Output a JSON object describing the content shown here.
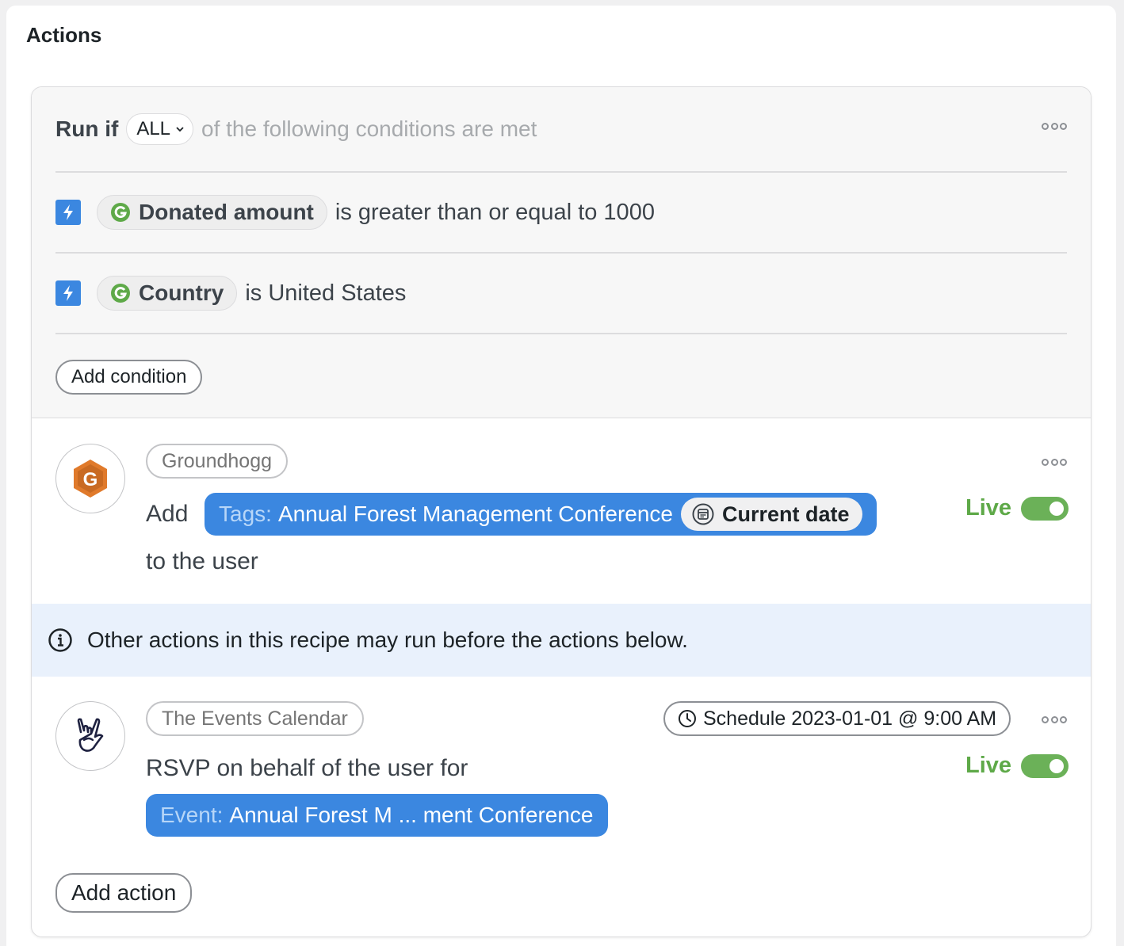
{
  "panel": {
    "title": "Actions"
  },
  "conditions": {
    "run_if_label": "Run if",
    "match_mode": "ALL",
    "run_if_suffix": "of the following conditions are met",
    "items": [
      {
        "field": "Donated amount",
        "rule": "is greater than or equal to 1000",
        "icon": "groundhogg-icon",
        "trigger_icon": "bolt-icon"
      },
      {
        "field": "Country",
        "rule": "is United States",
        "icon": "groundhogg-icon",
        "trigger_icon": "bolt-icon"
      }
    ],
    "add_condition_label": "Add condition"
  },
  "actions": [
    {
      "integration": "Groundhogg",
      "verb": "Add",
      "token_key": "Tags:",
      "token_value": "Annual Forest Management Conference",
      "date_chip": "Current date",
      "suffix": "to the user",
      "status": "Live",
      "icon": "groundhogg-logo"
    },
    {
      "integration": "The Events Calendar",
      "schedule": "Schedule 2023-01-01 @ 9:00 AM",
      "sentence": "RSVP on behalf of the user for",
      "token_key": "Event:",
      "token_value": "Annual Forest M ... ment Conference",
      "status": "Live",
      "icon": "rock-hand-logo"
    }
  ],
  "notice": {
    "text": "Other actions in this recipe may run before the actions below.",
    "icon": "info-icon"
  },
  "add_action_label": "Add action",
  "colors": {
    "accent_blue": "#3b87e0",
    "live_green": "#5ea948",
    "notice_bg": "#e9f1fc",
    "groundhogg_orange": "#e07a2b"
  }
}
